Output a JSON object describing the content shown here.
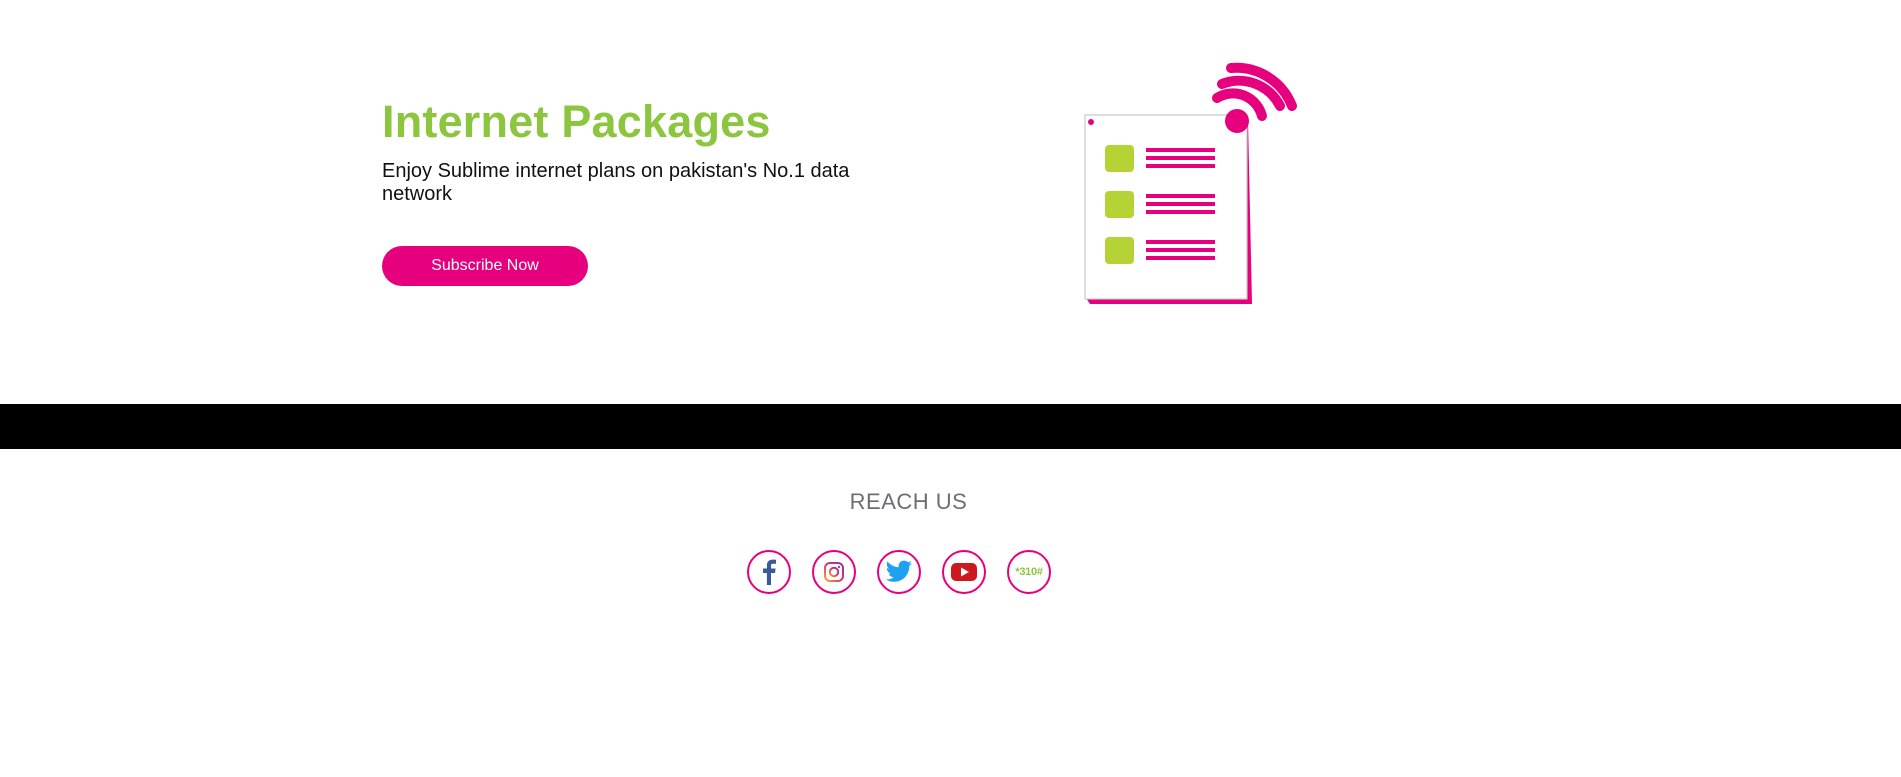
{
  "hero": {
    "title": "Internet Packages",
    "subtitle": "Enjoy Sublime internet plans on pakistan's No.1 data network",
    "cta_label": "Subscribe Now"
  },
  "footer": {
    "reach_title": "REACH US",
    "social": [
      {
        "name": "facebook",
        "icon": "facebook-icon"
      },
      {
        "name": "instagram",
        "icon": "instagram-icon"
      },
      {
        "name": "twitter",
        "icon": "twitter-icon"
      },
      {
        "name": "youtube",
        "icon": "youtube-icon"
      },
      {
        "name": "ussd",
        "icon": "ussd-code-icon",
        "label": "*310#"
      }
    ]
  },
  "colors": {
    "brand_pink": "#e6007e",
    "brand_green": "#8cc63f",
    "illustration_green": "#b5d335",
    "band": "#000000",
    "muted_text": "#6d6e71"
  }
}
